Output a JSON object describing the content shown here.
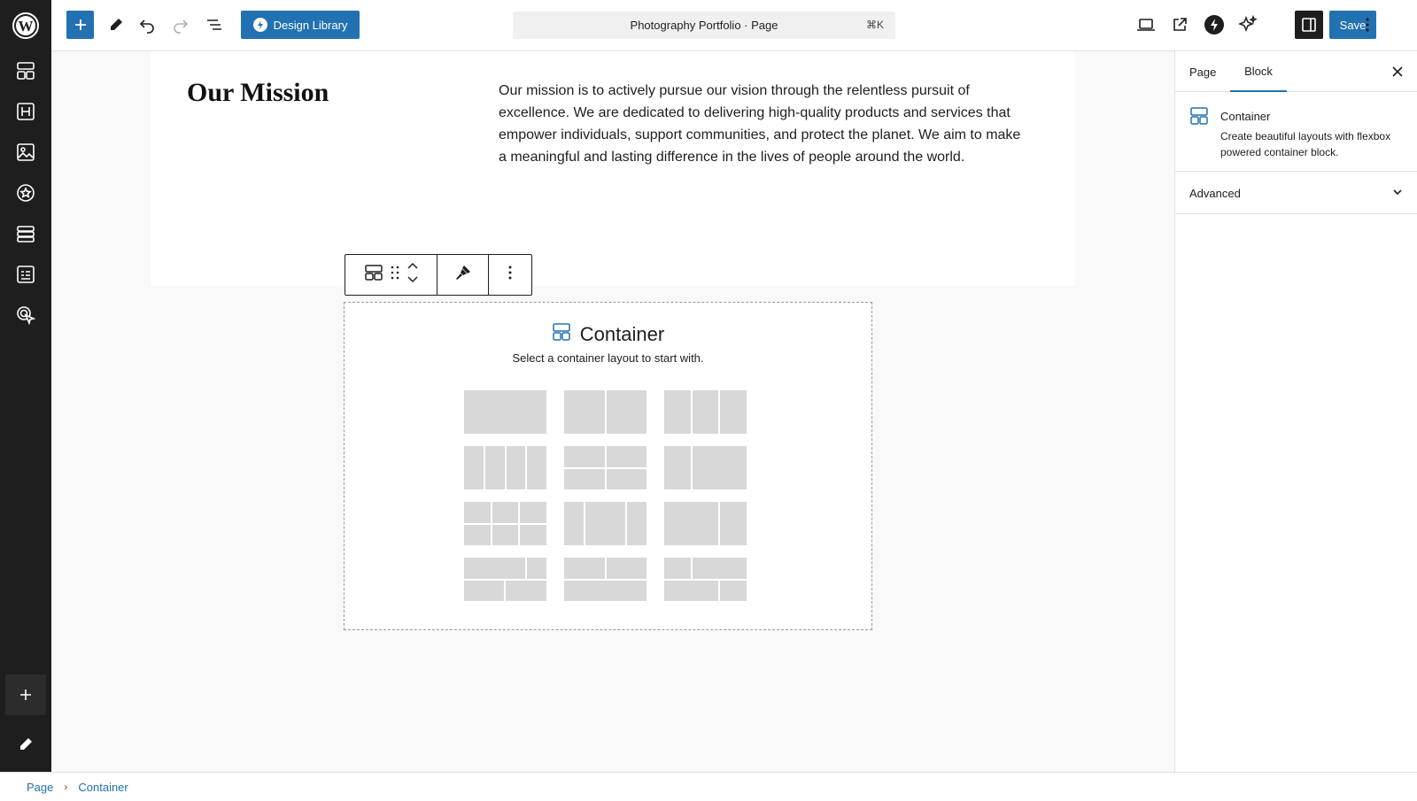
{
  "topbar": {
    "design_library_label": "Design Library",
    "document_title": "Photography Portfolio · Page",
    "shortcut": "⌘K",
    "save_label": "Save"
  },
  "canvas": {
    "mission_title": "Our Mission",
    "mission_text": "Our mission is to actively pursue our vision through the relentless pursuit of excellence. We are dedicated to delivering high-quality products and services that empower individuals, support communities, and protect the planet. We aim to make a meaningful and lasting difference in the lives of people around the world.",
    "container_title": "Container",
    "container_subtitle": "Select a container layout to start with."
  },
  "settings": {
    "tabs": [
      {
        "label": "Page"
      },
      {
        "label": "Block"
      }
    ],
    "active_tab": "Block",
    "block_title": "Container",
    "block_description": "Create beautiful layouts with flexbox powered container block.",
    "advanced_label": "Advanced"
  },
  "footer": {
    "breadcrumb": [
      {
        "label": "Page"
      },
      {
        "label": "Container"
      }
    ]
  },
  "colors": {
    "accent": "#2271b1",
    "rail": "#1e1e1e"
  }
}
